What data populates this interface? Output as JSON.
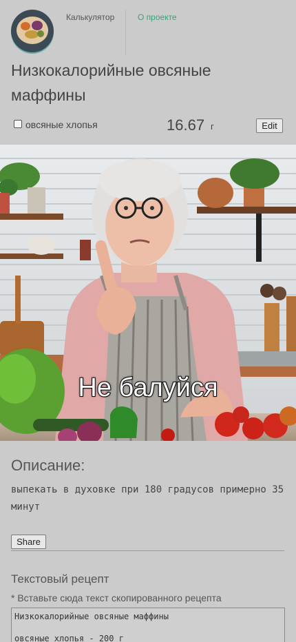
{
  "nav": {
    "calculator": "Калькулятор",
    "about": "О проекте"
  },
  "recipe": {
    "title": "Низкокалорийные овсяные маффины",
    "ingredient": {
      "name": "овсяные хлопья",
      "amount": "16.67",
      "unit": "г",
      "edit_label": "Edit",
      "checked": false
    },
    "image_caption": "Не балуйся",
    "description_heading": "Описание:",
    "description_text": "выпекать в духовке при 180 градусов примерно 35 минут",
    "share_label": "Share",
    "text_recipe_heading": "Текстовый рецепт",
    "text_recipe_hint": "* Вставьте сюда текст скопированного рецепта",
    "text_recipe_value": "Низкокалорийные овсяные маффины\n\nовсяные хлопья - 200 г"
  },
  "colors": {
    "background": "#cbcbcb",
    "accent_link": "#3aa376"
  },
  "icons": {
    "logo": "food-plate-logo",
    "checkbox": "checkbox-icon"
  }
}
